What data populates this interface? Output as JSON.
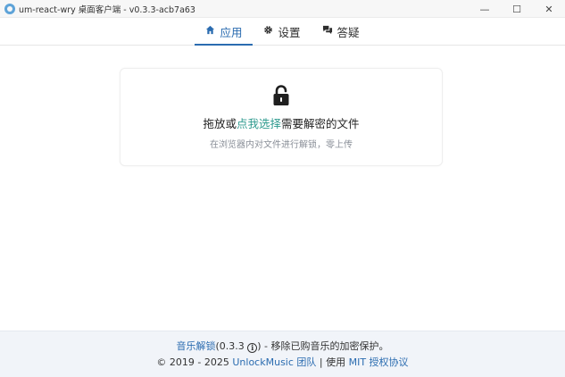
{
  "window": {
    "title": "um-react-wry 桌面客户端 - v0.3.3-acb7a63",
    "minimize_glyph": "—",
    "maximize_glyph": "☐",
    "close_glyph": "✕"
  },
  "tabs": [
    {
      "label": "应用",
      "icon": "home-icon",
      "active": true
    },
    {
      "label": "设置",
      "icon": "gear-icon",
      "active": false
    },
    {
      "label": "答疑",
      "icon": "chat-icon",
      "active": false
    }
  ],
  "dropzone": {
    "icon": "unlock-icon",
    "prefix": "拖放或",
    "link": "点我选择",
    "suffix": "需要解密的文件",
    "subtitle": "在浏览器内对文件进行解锁，零上传"
  },
  "footer": {
    "app_link": "音乐解锁",
    "version": "(0.3.3",
    "version_close": ")",
    "tagline": " - 移除已购音乐的加密保护。",
    "copyright": "© 2019 - 2025 ",
    "team_link": "UnlockMusic 团队",
    "separator": " | ",
    "license_prefix": "使用 ",
    "license_link": "MIT 授权协议"
  },
  "colors": {
    "accent": "#2b6cb0",
    "link_teal": "#2f9b8f",
    "footer_bg": "#f1f4f9"
  }
}
